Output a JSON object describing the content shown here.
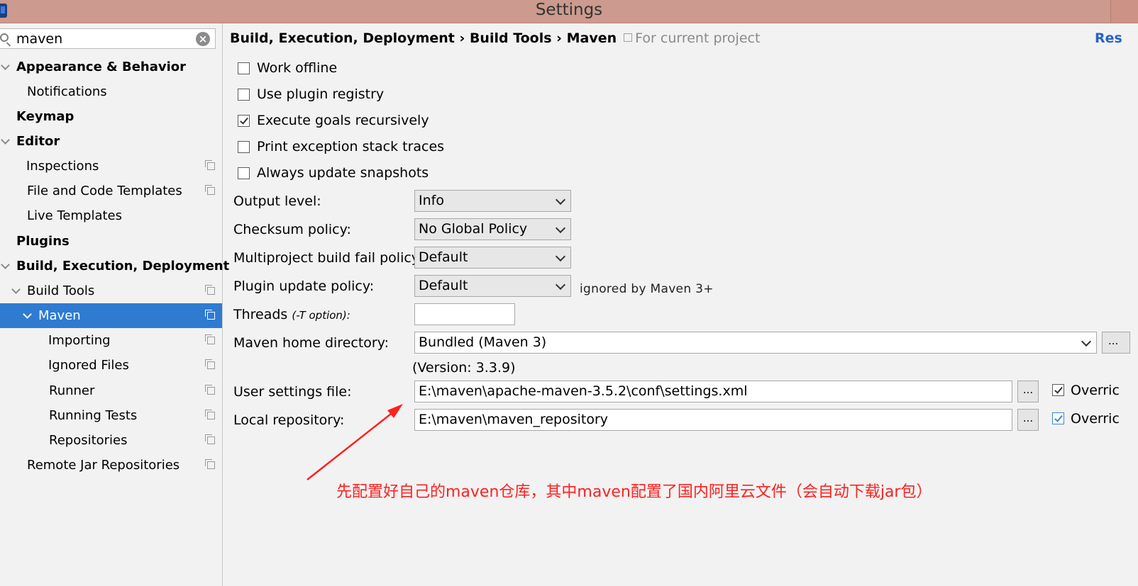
{
  "window": {
    "title": "Settings"
  },
  "sidebar": {
    "search_value": "maven",
    "items": [
      {
        "label": "Appearance & Behavior"
      },
      {
        "label": "Notifications"
      },
      {
        "label": "Keymap"
      },
      {
        "label": "Editor"
      },
      {
        "label": "Inspections"
      },
      {
        "label": "File and Code Templates"
      },
      {
        "label": "Live Templates"
      },
      {
        "label": "Plugins"
      },
      {
        "label": "Build, Execution, Deployment"
      },
      {
        "label": "Build Tools"
      },
      {
        "label": "Maven"
      },
      {
        "label": "Importing"
      },
      {
        "label": "Ignored Files"
      },
      {
        "label": "Runner"
      },
      {
        "label": "Running Tests"
      },
      {
        "label": "Repositories"
      },
      {
        "label": "Remote Jar Repositories"
      }
    ]
  },
  "breadcrumb": {
    "path": "Build, Execution, Deployment › Build Tools › Maven",
    "scope": "For current project",
    "reset": "Res"
  },
  "options": {
    "work_offline": {
      "label": "Work offline",
      "checked": false
    },
    "use_plugin_registry": {
      "label": "Use plugin registry",
      "checked": false
    },
    "execute_goals_recursively": {
      "label": "Execute goals recursively",
      "checked": true
    },
    "print_exception_stack_traces": {
      "label": "Print exception stack traces",
      "checked": false
    },
    "always_update_snapshots": {
      "label": "Always update snapshots",
      "checked": false
    }
  },
  "form": {
    "output_level": {
      "label": "Output level:",
      "value": "Info"
    },
    "checksum_policy": {
      "label": "Checksum policy:",
      "value": "No Global Policy"
    },
    "multiproject_fail_policy": {
      "label": "Multiproject build fail policy:",
      "value": "Default"
    },
    "plugin_update_policy": {
      "label": "Plugin update policy:",
      "value": "Default",
      "note": "ignored by Maven 3+"
    },
    "threads": {
      "label": "Threads",
      "hint": "(-T option):",
      "value": ""
    },
    "maven_home": {
      "label": "Maven home directory:",
      "value": "Bundled (Maven 3)",
      "version": "(Version: 3.3.9)"
    },
    "user_settings": {
      "label": "User settings file:",
      "value": "E:\\maven\\apache-maven-3.5.2\\conf\\settings.xml",
      "override": "Overric"
    },
    "local_repository": {
      "label": "Local repository:",
      "value": "E:\\maven\\maven_repository",
      "override": "Overric"
    },
    "browse_label": "..."
  },
  "annotation": {
    "text": "先配置好自己的maven仓库，其中maven配置了国内阿里云文件（会自动下载jar包）",
    "color": "#ff2020"
  },
  "colors": {
    "accent": "#2f7bd1",
    "titlebar": "#cc9a8e",
    "link": "#2862c4"
  },
  "icons": [
    "search-icon",
    "clear-icon",
    "chevron-down-icon",
    "project-scope-icon",
    "app-icon"
  ]
}
